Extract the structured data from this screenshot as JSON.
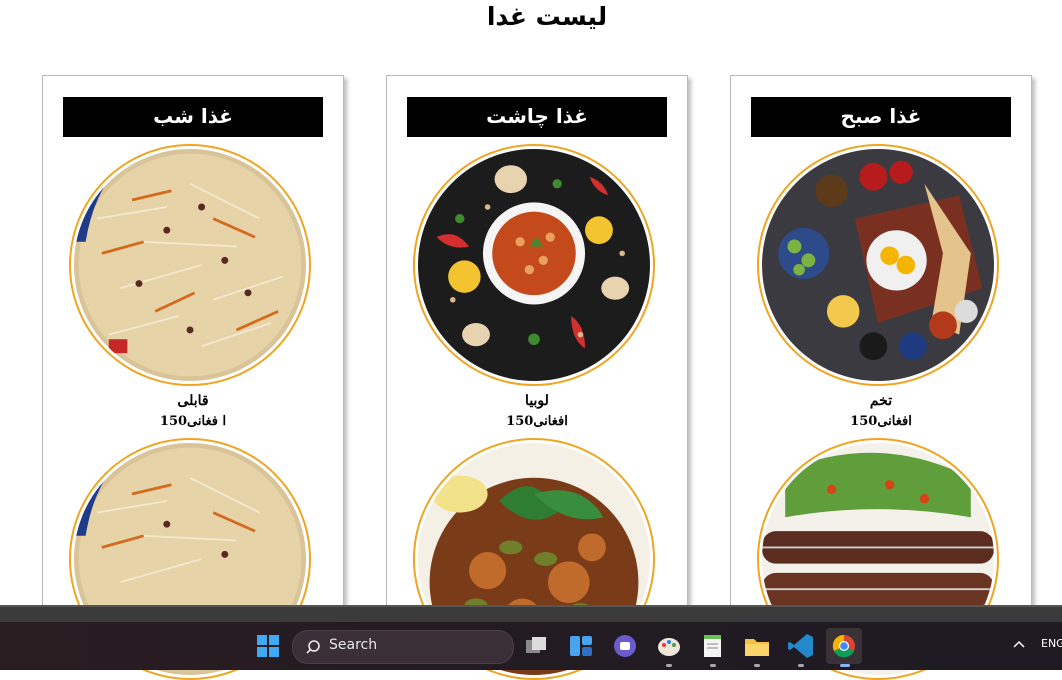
{
  "page": {
    "title": "لیست غدا"
  },
  "cards": [
    {
      "header": "غذا صبح",
      "dish": {
        "name": "تخم",
        "price": "افغانی150",
        "icon": "breakfast-spread-image"
      },
      "next_dish_icon": "kebab-image"
    },
    {
      "header": "غذا چاشت",
      "dish": {
        "name": "لوبیا",
        "price": "افغانی150",
        "icon": "bean-stew-image"
      },
      "next_dish_icon": "okra-stew-image"
    },
    {
      "header": "غذا شب",
      "dish": {
        "name": "قابلی",
        "price": "ا فغانی150",
        "icon": "kabuli-pulao-image"
      },
      "next_dish_icon": "kabuli-pulao-image"
    }
  ],
  "taskbar": {
    "search_label": "Search",
    "language": "ENG",
    "apps": [
      "windows-start-icon",
      "task-view-icon",
      "widgets-icon",
      "teams-chat-icon",
      "paint-icon",
      "notepad-icon",
      "file-explorer-icon",
      "vscode-icon",
      "chrome-icon"
    ]
  }
}
